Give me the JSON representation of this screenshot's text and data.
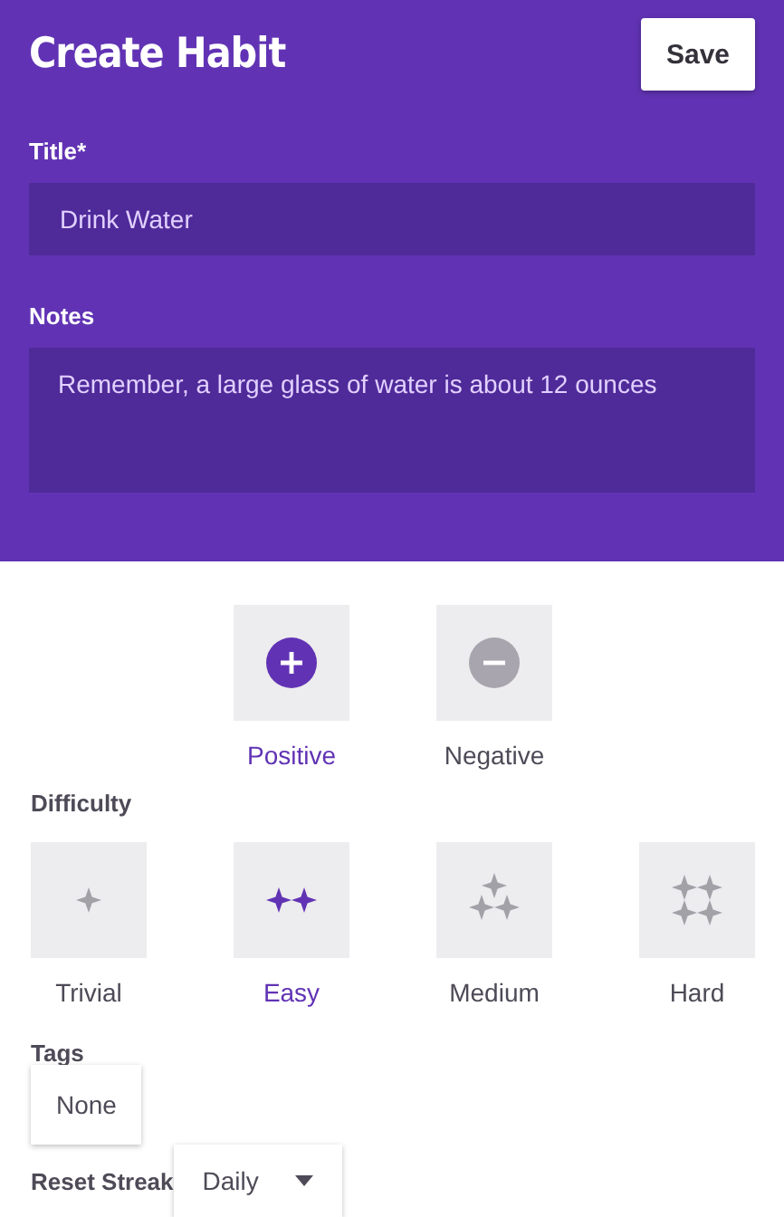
{
  "header": {
    "title": "Create Habit",
    "save_button": "Save"
  },
  "fields": [
    {
      "label": "Title*",
      "kind": "input",
      "value": "Drink Water"
    },
    {
      "label": "Notes",
      "kind": "textarea",
      "value": "Remember, a large glass of water is about 12 ounces"
    }
  ],
  "direction": [
    {
      "label": "Positive",
      "kind": "plus",
      "selected": true
    },
    {
      "label": "Negative",
      "kind": "minus",
      "selected": false
    }
  ],
  "difficulty": {
    "label": "Difficulty",
    "options": [
      {
        "label": "Trivial",
        "kind": "single",
        "selected": false
      },
      {
        "label": "Easy",
        "kind": "double",
        "selected": true
      },
      {
        "label": "Medium",
        "kind": "triple",
        "selected": false
      },
      {
        "label": "Hard",
        "kind": "quad",
        "selected": false
      }
    ]
  },
  "tags": {
    "label": "Tags",
    "value": "None"
  },
  "reset_streak": {
    "label": "Reset Streak",
    "value": "Daily"
  }
}
